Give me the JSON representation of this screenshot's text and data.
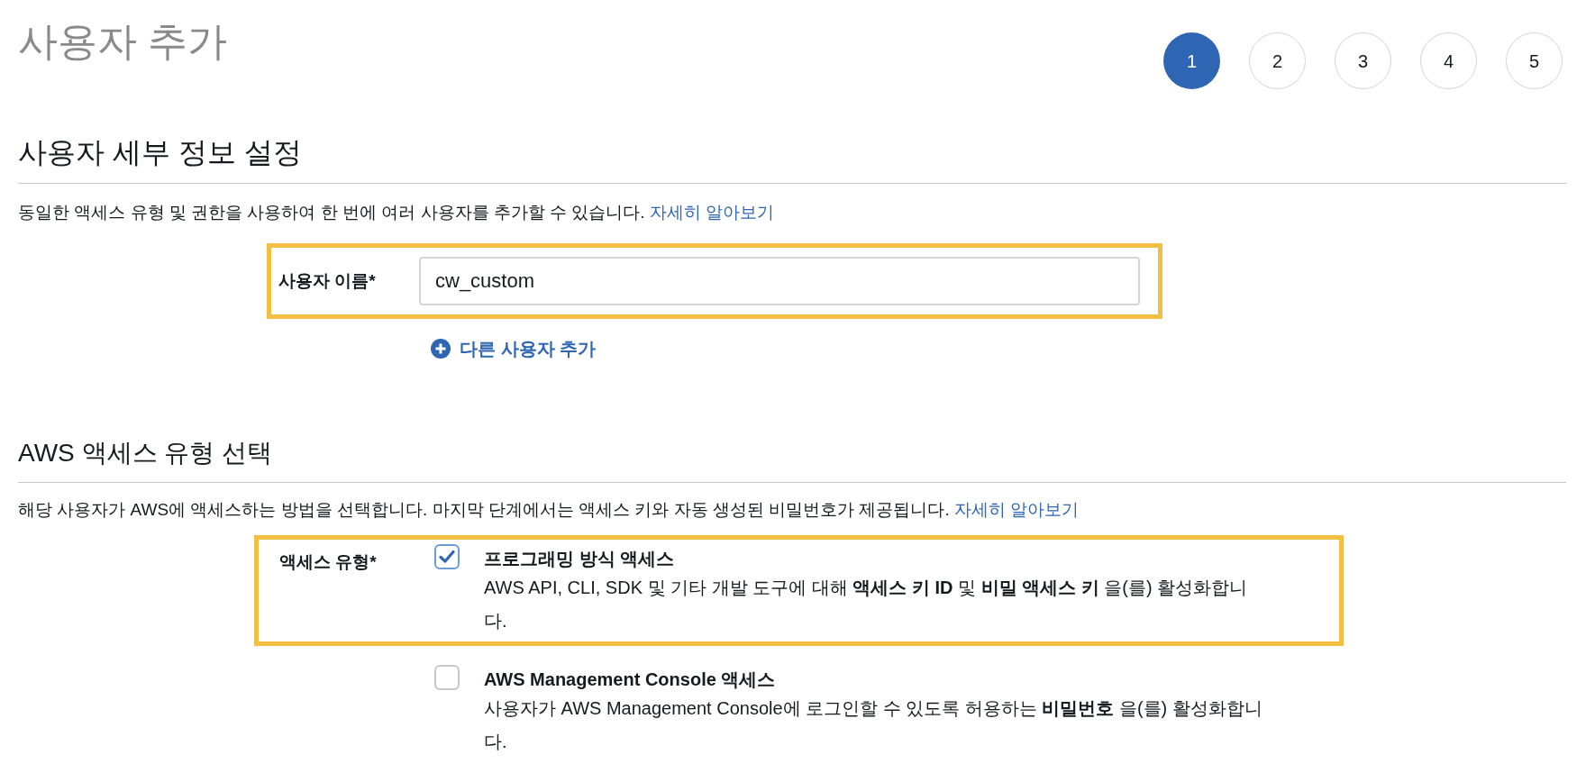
{
  "page_title": "사용자 추가",
  "steps": [
    {
      "label": "1",
      "selected": true
    },
    {
      "label": "2",
      "selected": false
    },
    {
      "label": "3",
      "selected": false
    },
    {
      "label": "4",
      "selected": false
    },
    {
      "label": "5",
      "selected": false
    }
  ],
  "user_details": {
    "heading": "사용자 세부 정보 설정",
    "description": "동일한 액세스 유형 및 권한을 사용하여 한 번에 여러 사용자를 추가할 수 있습니다.",
    "link": "자세히 알아보기",
    "field_label": "사용자 이름*",
    "field_value": "cw_custom",
    "add_user_link": "다른 사용자 추가"
  },
  "access_type": {
    "heading": "AWS 액세스 유형 선택",
    "description": "해당 사용자가 AWS에 액세스하는 방법을 선택합니다. 마지막 단계에서는 액세스 키와 자동 생성된 비밀번호가 제공됩니다.",
    "link": "자세히 알아보기",
    "field_label": "액세스 유형*",
    "options": [
      {
        "title": "프로그래밍 방식 액세스",
        "description": "AWS API, CLI, SDK 및 기타 개발 도구에 대해 **액세스 키 ID** 및 **비밀 액세스 키** 을(를) 활성화합니다.",
        "checked": true,
        "highlighted": true
      },
      {
        "title": "AWS Management Console 액세스",
        "description": "사용자가 AWS Management Console에 로그인할 수 있도록 허용하는 **비밀번호** 을(를) 활성화합니다.",
        "checked": false,
        "highlighted": false
      }
    ]
  }
}
